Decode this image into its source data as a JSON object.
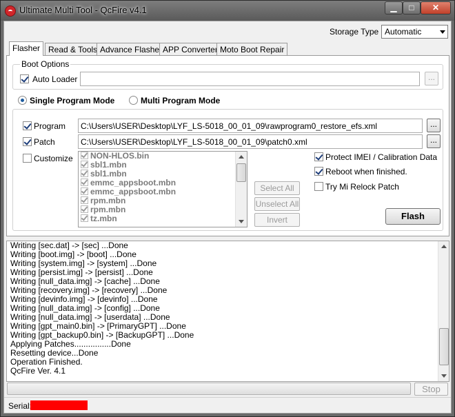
{
  "window": {
    "title": "Ultimate Multi Tool - QcFire v4.1",
    "controls": {
      "minimize": "▁",
      "maximize": "□",
      "close": "✕"
    }
  },
  "storage": {
    "label": "Storage Type",
    "selected": "Automatic"
  },
  "tabs": [
    {
      "label": "Flasher",
      "active": true
    },
    {
      "label": "Read & Tools",
      "active": false
    },
    {
      "label": "Advance Flasher",
      "active": false
    },
    {
      "label": "APP Converter",
      "active": false
    },
    {
      "label": "Moto Boot Repair",
      "active": false
    }
  ],
  "boot_options": {
    "title": "Boot Options",
    "auto_loader": {
      "label": "Auto Loader",
      "checked": true,
      "value": ""
    },
    "browse": "..."
  },
  "modes": {
    "single": {
      "label": "Single Program Mode",
      "selected": true
    },
    "multi": {
      "label": "Multi Program Mode",
      "selected": false
    }
  },
  "program": {
    "label": "Program",
    "checked": true,
    "value": "C:\\Users\\USER\\Desktop\\LYF_LS-5018_00_01_09\\rawprogram0_restore_efs.xml",
    "browse": "..."
  },
  "patch": {
    "label": "Patch",
    "checked": true,
    "value": "C:\\Users\\USER\\Desktop\\LYF_LS-5018_00_01_09\\patch0.xml",
    "browse": "..."
  },
  "customize": {
    "label": "Customize",
    "checked": false
  },
  "partitions": [
    {
      "name": "NON-HLOS.bin",
      "checked": true
    },
    {
      "name": "sbl1.mbn",
      "checked": true
    },
    {
      "name": "sbl1.mbn",
      "checked": true
    },
    {
      "name": "emmc_appsboot.mbn",
      "checked": true
    },
    {
      "name": "emmc_appsboot.mbn",
      "checked": true
    },
    {
      "name": "rpm.mbn",
      "checked": true
    },
    {
      "name": "rpm.mbn",
      "checked": true
    },
    {
      "name": "tz.mbn",
      "checked": true
    }
  ],
  "list_buttons": {
    "select_all": "Select All",
    "unselect_all": "Unselect All",
    "invert": "Invert"
  },
  "options": {
    "protect_imei": {
      "label": "Protect IMEI / Calibration Data",
      "checked": true
    },
    "reboot": {
      "label": "Reboot when finished.",
      "checked": true
    },
    "mi_relock": {
      "label": "Try Mi Relock Patch",
      "checked": false
    }
  },
  "flash_button": "Flash",
  "log": [
    "Writing [sec.dat] -> [sec] ...Done",
    "Writing [boot.img] -> [boot] ...Done",
    "Writing [system.img] -> [system] ...Done",
    "Writing [persist.img] -> [persist] ...Done",
    "Writing [null_data.img] -> [cache] ...Done",
    "Writing [recovery.img] -> [recovery] ...Done",
    "Writing [devinfo.img] -> [devinfo] ...Done",
    "Writing [null_data.img] -> [config] ...Done",
    "Writing [null_data.img] -> [userdata] ...Done",
    "Writing [gpt_main0.bin] -> [PrimaryGPT] ...Done",
    "Writing [gpt_backup0.bin] -> [BackupGPT] ...Done",
    "Applying Patches................Done",
    "Resetting device...Done",
    "Operation Finished.",
    "QcFire Ver. 4.1"
  ],
  "progress": {
    "value": 0
  },
  "stop_button": "Stop",
  "status": {
    "serial_label": "Serial:",
    "serial_redaction_color": "#ff0000"
  }
}
